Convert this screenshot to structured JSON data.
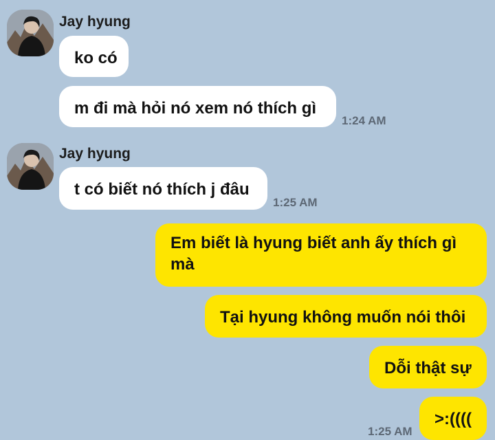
{
  "colors": {
    "background": "#b1c6da",
    "incoming_bubble": "#ffffff",
    "outgoing_bubble": "#fee500",
    "timestamp": "#5d6875"
  },
  "groups": [
    {
      "sender": "Jay hyung",
      "avatar_icon": "profile-photo",
      "messages": [
        {
          "text": "ko có"
        },
        {
          "text": "m đi mà hỏi nó xem nó thích gì",
          "time": "1:24 AM"
        }
      ]
    },
    {
      "sender": "Jay hyung",
      "avatar_icon": "profile-photo",
      "messages": [
        {
          "text": "t có biết nó thích j đâu",
          "time": "1:25 AM"
        }
      ]
    }
  ],
  "outgoing": [
    {
      "text": "Em biết là hyung biết anh ấy thích gì mà"
    },
    {
      "text": "Tại hyung không muốn nói thôi"
    },
    {
      "text": "Dỗi thật sự"
    },
    {
      "text": ">:((((",
      "time": "1:25 AM"
    }
  ]
}
